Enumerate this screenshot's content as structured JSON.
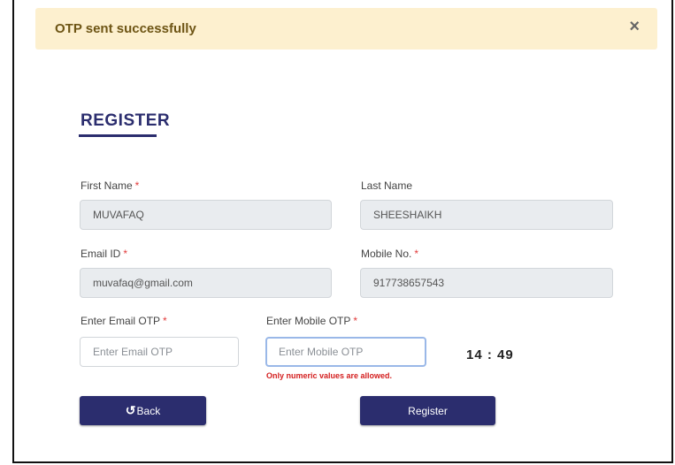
{
  "alert": {
    "message": "OTP sent successfully",
    "close_glyph": "×"
  },
  "form": {
    "title": "REGISTER",
    "required_mark": "*",
    "first_name": {
      "label": "First Name",
      "value": "MUVAFAQ"
    },
    "last_name": {
      "label": "Last Name",
      "value": "SHEESHAIKH"
    },
    "email": {
      "label": "Email ID",
      "value": "muvafaq@gmail.com"
    },
    "mobile": {
      "label": "Mobile No.",
      "value": "917738657543"
    },
    "email_otp": {
      "label": "Enter Email OTP",
      "placeholder": "Enter Email OTP"
    },
    "mobile_otp": {
      "label": "Enter Mobile OTP",
      "placeholder": "Enter Mobile OTP",
      "error": "Only numeric values are allowed."
    },
    "timer": "14 : 49"
  },
  "buttons": {
    "back_label": "Back",
    "back_icon": "undo-icon",
    "register_label": "Register"
  },
  "colors": {
    "primary": "#2b2d6e",
    "alert_bg": "#fdf0cf",
    "error": "#d42020"
  }
}
